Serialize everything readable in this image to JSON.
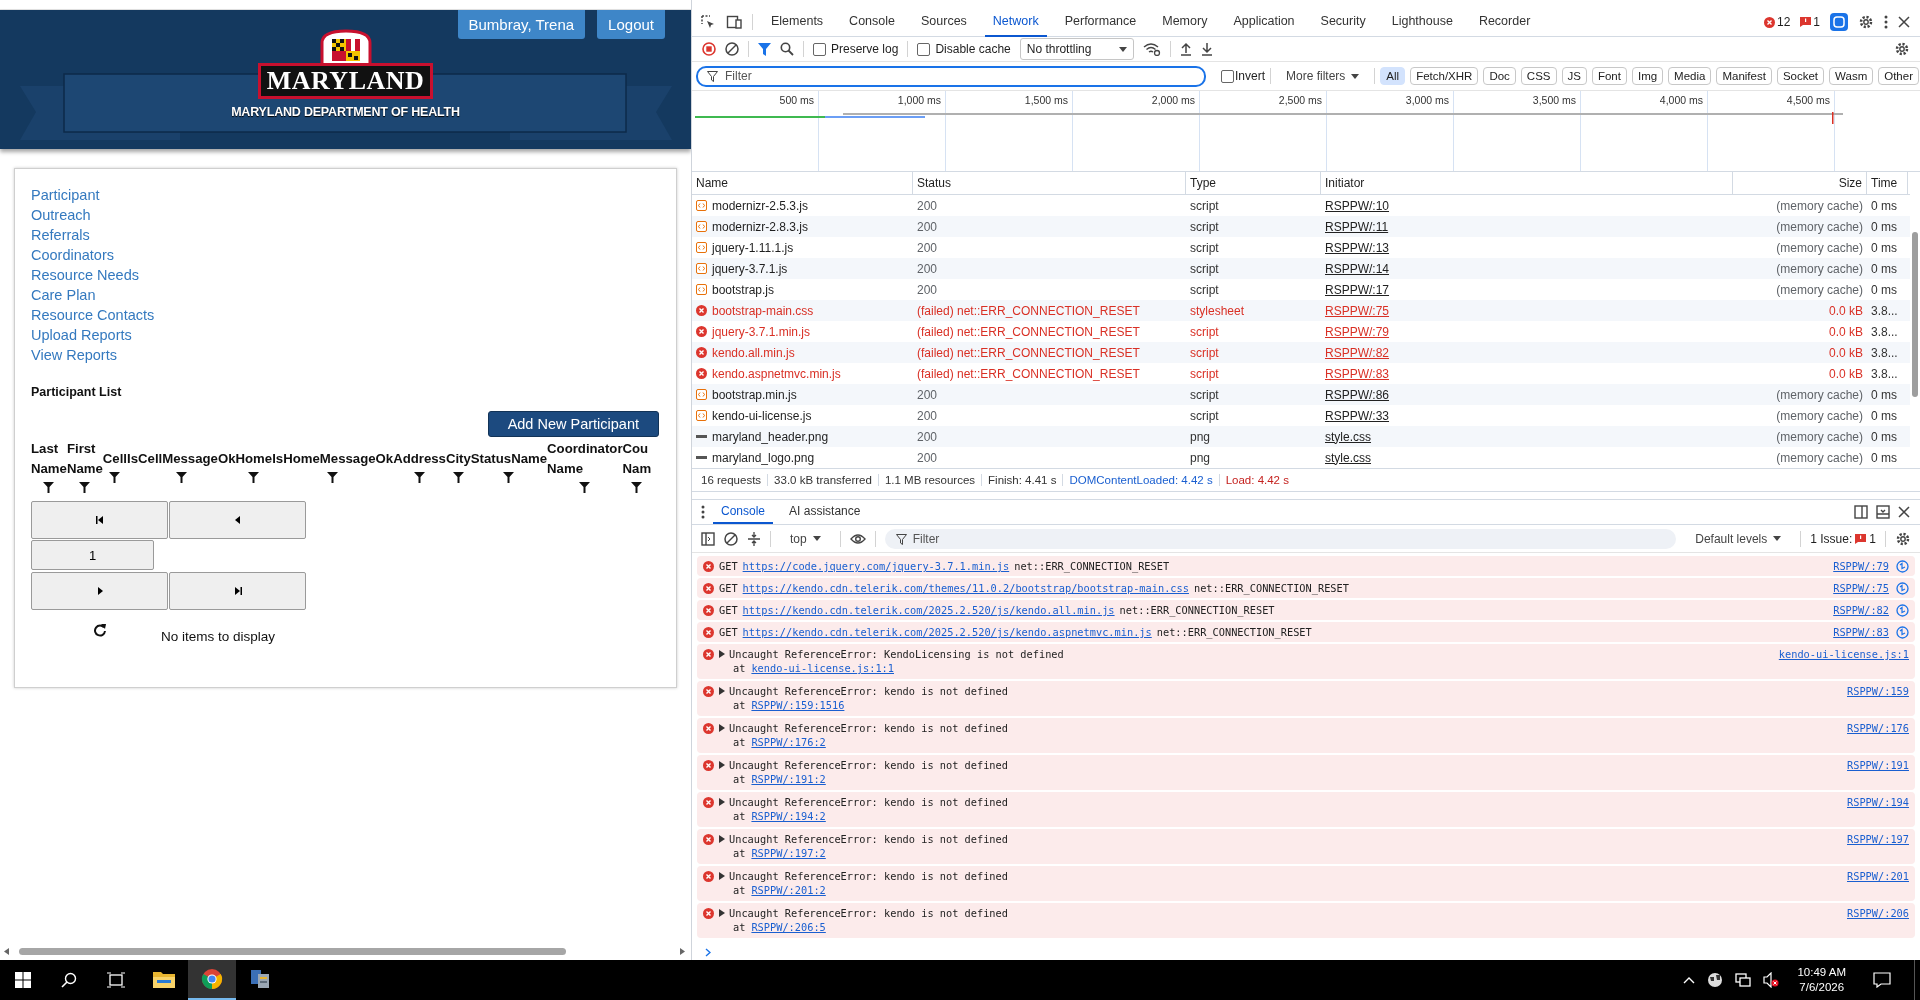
{
  "page": {
    "user_button": "Bumbray, Trena",
    "logout_button": "Logout",
    "logo_text": "MARYLAND",
    "department": "MARYLAND DEPARTMENT OF HEALTH",
    "nav_links": [
      "Participant",
      "Outreach",
      "Referrals",
      "Coordinators",
      "Resource Needs",
      "Care Plan",
      "Resource Contacts",
      "Upload Reports",
      "View Reports"
    ],
    "section_title": "Participant List",
    "add_button": "Add New Participant",
    "grid_columns": [
      {
        "lines": [
          "Last",
          "Name"
        ]
      },
      {
        "lines": [
          "First",
          "Name"
        ]
      },
      {
        "lines": [
          "Cell"
        ]
      },
      {
        "lines": [
          "IsCellMessageOk"
        ]
      },
      {
        "lines": [
          "Home"
        ]
      },
      {
        "lines": [
          "IsHomeMessageOk"
        ]
      },
      {
        "lines": [
          "Address"
        ]
      },
      {
        "lines": [
          "City"
        ]
      },
      {
        "lines": [
          "StatusName"
        ]
      },
      {
        "lines": [
          "Coordinator",
          "Name"
        ]
      },
      {
        "lines": [
          "Cou",
          "Nam"
        ]
      }
    ],
    "pager": {
      "page": "1"
    },
    "empty_message": "No items to display"
  },
  "devtools": {
    "tabs": [
      {
        "label": "Elements",
        "selected": false
      },
      {
        "label": "Console",
        "selected": false
      },
      {
        "label": "Sources",
        "selected": false
      },
      {
        "label": "Network",
        "selected": true
      },
      {
        "label": "Performance",
        "selected": false
      },
      {
        "label": "Memory",
        "selected": false
      },
      {
        "label": "Application",
        "selected": false
      },
      {
        "label": "Security",
        "selected": false
      },
      {
        "label": "Lighthouse",
        "selected": false
      },
      {
        "label": "Recorder",
        "selected": false
      }
    ],
    "error_count": "12",
    "issue_count": "1",
    "network": {
      "options": [
        {
          "label": "Preserve log",
          "checked": false
        },
        {
          "label": "Disable cache",
          "checked": false
        }
      ],
      "throttling": "No throttling",
      "filter_placeholder": "Filter",
      "invert": {
        "label": "Invert",
        "checked": false
      },
      "more_filters": "More filters",
      "type_filters": [
        {
          "label": "All",
          "selected": true
        },
        {
          "label": "Fetch/XHR",
          "selected": false
        },
        {
          "label": "Doc",
          "selected": false
        },
        {
          "label": "CSS",
          "selected": false
        },
        {
          "label": "JS",
          "selected": false
        },
        {
          "label": "Font",
          "selected": false
        },
        {
          "label": "Img",
          "selected": false
        },
        {
          "label": "Media",
          "selected": false
        },
        {
          "label": "Manifest",
          "selected": false
        },
        {
          "label": "Socket",
          "selected": false
        },
        {
          "label": "Wasm",
          "selected": false
        },
        {
          "label": "Other",
          "selected": false
        }
      ],
      "timeline_ticks": [
        "500 ms",
        "1,000 ms",
        "1,500 ms",
        "2,000 ms",
        "2,500 ms",
        "3,000 ms",
        "3,500 ms",
        "4,000 ms",
        "4,500 ms"
      ],
      "columns": [
        "Name",
        "Status",
        "Type",
        "Initiator",
        "Size",
        "Time"
      ],
      "rows": [
        {
          "kind": "script",
          "name": "modernizr-2.5.3.js",
          "status": "200",
          "type": "script",
          "initiator": "RSPPW/:10",
          "size": "(memory cache)",
          "time": "0 ms"
        },
        {
          "kind": "script",
          "name": "modernizr-2.8.3.js",
          "status": "200",
          "type": "script",
          "initiator": "RSPPW/:11",
          "size": "(memory cache)",
          "time": "0 ms"
        },
        {
          "kind": "script",
          "name": "jquery-1.11.1.js",
          "status": "200",
          "type": "script",
          "initiator": "RSPPW/:13",
          "size": "(memory cache)",
          "time": "0 ms"
        },
        {
          "kind": "script",
          "name": "jquery-3.7.1.js",
          "status": "200",
          "type": "script",
          "initiator": "RSPPW/:14",
          "size": "(memory cache)",
          "time": "0 ms"
        },
        {
          "kind": "script",
          "name": "bootstrap.js",
          "status": "200",
          "type": "script",
          "initiator": "RSPPW/:17",
          "size": "(memory cache)",
          "time": "0 ms"
        },
        {
          "kind": "failed",
          "name": "bootstrap-main.css",
          "status": "(failed) net::ERR_CONNECTION_RESET",
          "type": "stylesheet",
          "initiator": "RSPPW/:75",
          "size": "0.0 kB",
          "time": "3.8..."
        },
        {
          "kind": "failed",
          "name": "jquery-3.7.1.min.js",
          "status": "(failed) net::ERR_CONNECTION_RESET",
          "type": "script",
          "initiator": "RSPPW/:79",
          "size": "0.0 kB",
          "time": "3.8..."
        },
        {
          "kind": "failed",
          "name": "kendo.all.min.js",
          "status": "(failed) net::ERR_CONNECTION_RESET",
          "type": "script",
          "initiator": "RSPPW/:82",
          "size": "0.0 kB",
          "time": "3.8..."
        },
        {
          "kind": "failed",
          "name": "kendo.aspnetmvc.min.js",
          "status": "(failed) net::ERR_CONNECTION_RESET",
          "type": "script",
          "initiator": "RSPPW/:83",
          "size": "0.0 kB",
          "time": "3.8..."
        },
        {
          "kind": "script",
          "name": "bootstrap.min.js",
          "status": "200",
          "type": "script",
          "initiator": "RSPPW/:86",
          "size": "(memory cache)",
          "time": "0 ms"
        },
        {
          "kind": "script",
          "name": "kendo-ui-license.js",
          "status": "200",
          "type": "script",
          "initiator": "RSPPW/:33",
          "size": "(memory cache)",
          "time": "0 ms"
        },
        {
          "kind": "image",
          "name": "maryland_header.png",
          "status": "200",
          "type": "png",
          "initiator": "style.css",
          "size": "(memory cache)",
          "time": "0 ms"
        },
        {
          "kind": "image",
          "name": "maryland_logo.png",
          "status": "200",
          "type": "png",
          "initiator": "style.css",
          "size": "(memory cache)",
          "time": "0 ms"
        }
      ],
      "summary": [
        {
          "kind": "plain",
          "text": "16 requests"
        },
        {
          "kind": "plain",
          "text": "33.0 kB transferred"
        },
        {
          "kind": "plain",
          "text": "1.1 MB resources"
        },
        {
          "kind": "plain",
          "text": "Finish: 4.41 s"
        },
        {
          "kind": "dom",
          "text": "DOMContentLoaded: 4.42 s"
        },
        {
          "kind": "load",
          "text": "Load: 4.42 s"
        }
      ]
    },
    "console": {
      "tabs": [
        {
          "label": "Console",
          "selected": true
        },
        {
          "label": "AI assistance",
          "selected": false
        }
      ],
      "context": "top",
      "filter_placeholder": "Filter",
      "levels": "Default levels",
      "issues_label": "1 Issue:",
      "issues_count": "1",
      "messages": [
        {
          "kind": "get",
          "method": "GET",
          "url": "https://code.jquery.com/jquery-3.7.1.min.js",
          "error": "net::ERR_CONNECTION_RESET",
          "source": "RSPPW/:79"
        },
        {
          "kind": "get",
          "method": "GET",
          "url": "https://kendo.cdn.telerik.com/themes/11.0.2/bootstrap/bootstrap-main.css",
          "error": "net::ERR_CONNECTION_RESET",
          "source": "RSPPW/:75"
        },
        {
          "kind": "get",
          "method": "GET",
          "url": "https://kendo.cdn.telerik.com/2025.2.520/js/kendo.all.min.js",
          "error": "net::ERR_CONNECTION_RESET",
          "source": "RSPPW/:82"
        },
        {
          "kind": "get",
          "method": "GET",
          "url": "https://kendo.cdn.telerik.com/2025.2.520/js/kendo.aspnetmvc.min.js",
          "error": "net::ERR_CONNECTION_RESET",
          "source": "RSPPW/:83"
        },
        {
          "kind": "exception",
          "text": "Uncaught ReferenceError: KendoLicensing is not defined",
          "at": "at",
          "location": "kendo-ui-license.js:1:1",
          "source": "kendo-ui-license.js:1"
        },
        {
          "kind": "exception",
          "text": "Uncaught ReferenceError: kendo is not defined",
          "at": "at",
          "location": "RSPPW/:159:1516",
          "source": "RSPPW/:159"
        },
        {
          "kind": "exception",
          "text": "Uncaught ReferenceError: kendo is not defined",
          "at": "at",
          "location": "RSPPW/:176:2",
          "source": "RSPPW/:176"
        },
        {
          "kind": "exception",
          "text": "Uncaught ReferenceError: kendo is not defined",
          "at": "at",
          "location": "RSPPW/:191:2",
          "source": "RSPPW/:191"
        },
        {
          "kind": "exception",
          "text": "Uncaught ReferenceError: kendo is not defined",
          "at": "at",
          "location": "RSPPW/:194:2",
          "source": "RSPPW/:194"
        },
        {
          "kind": "exception",
          "text": "Uncaught ReferenceError: kendo is not defined",
          "at": "at",
          "location": "RSPPW/:197:2",
          "source": "RSPPW/:197"
        },
        {
          "kind": "exception",
          "text": "Uncaught ReferenceError: kendo is not defined",
          "at": "at",
          "location": "RSPPW/:201:2",
          "source": "RSPPW/:201"
        },
        {
          "kind": "exception",
          "text": "Uncaught ReferenceError: kendo is not defined",
          "at": "at",
          "location": "RSPPW/:206:5",
          "source": "RSPPW/:206"
        }
      ]
    }
  },
  "taskbar": {
    "apps": [
      {
        "kind": "explorer",
        "selected": false
      },
      {
        "kind": "chrome",
        "selected": true
      },
      {
        "kind": "app",
        "selected": false
      }
    ],
    "time": "10:49 AM",
    "date": "7/6/2026"
  }
}
